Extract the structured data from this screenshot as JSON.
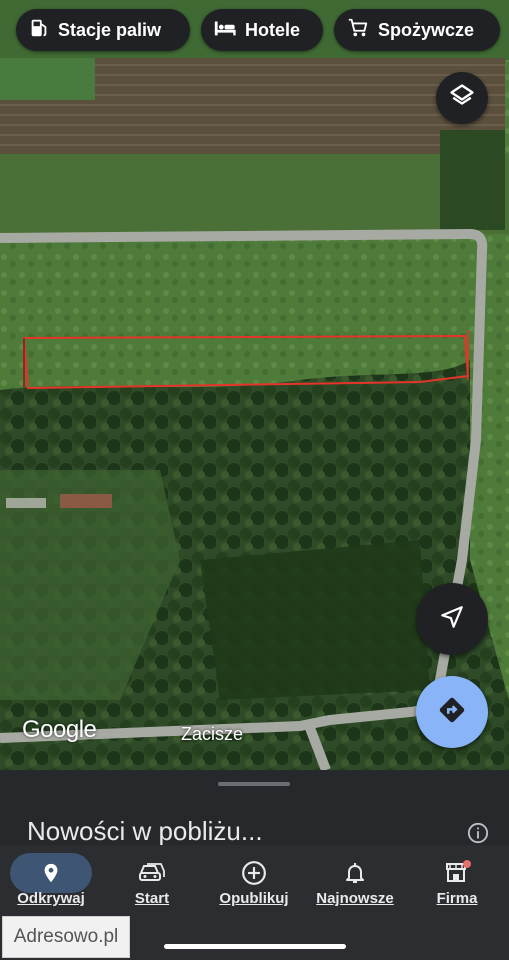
{
  "chips": [
    {
      "label": "Stacje paliw",
      "icon": "gas-station-icon"
    },
    {
      "label": "Hotele",
      "icon": "bed-icon"
    },
    {
      "label": "Spożywcze",
      "icon": "shopping-cart-icon"
    }
  ],
  "map": {
    "attribution": "Google",
    "street_label": "Zacisze",
    "layers_icon": "layers-icon",
    "location_icon": "navigation-arrow-icon",
    "directions_icon": "directions-icon",
    "parcel_outline_color": "#e5352a",
    "directions_color": "#8ab4f8"
  },
  "sheet": {
    "title": "Nowości w pobliżu...",
    "info_icon": "info-icon"
  },
  "nav": {
    "items": [
      {
        "label": "Odkrywaj",
        "icon": "location-pin-icon",
        "active": true
      },
      {
        "label": "Start",
        "icon": "car-icon"
      },
      {
        "label": "Opublikuj",
        "icon": "add-circle-icon"
      },
      {
        "label": "Najnowsze",
        "icon": "bell-icon"
      },
      {
        "label": "Firma",
        "icon": "storefront-icon",
        "badge": true
      }
    ]
  },
  "watermark": "Adresowo.pl"
}
